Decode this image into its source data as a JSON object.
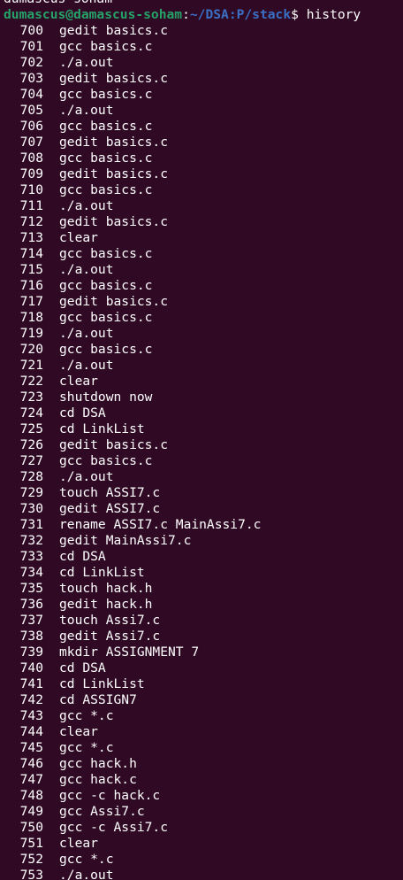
{
  "terminal": {
    "background": "#300a24",
    "previous_line": "dumascus-soham",
    "prompt": {
      "user_host": "dumascus@damascus-soham",
      "separator": ":",
      "path": "~/DSA:P/stack",
      "symbol": "$",
      "command": " history"
    },
    "history": [
      {
        "num": "700",
        "cmd": "gedit basics.c"
      },
      {
        "num": "701",
        "cmd": "gcc basics.c"
      },
      {
        "num": "702",
        "cmd": "./a.out"
      },
      {
        "num": "703",
        "cmd": "gedit basics.c"
      },
      {
        "num": "704",
        "cmd": "gcc basics.c"
      },
      {
        "num": "705",
        "cmd": "./a.out"
      },
      {
        "num": "706",
        "cmd": "gcc basics.c"
      },
      {
        "num": "707",
        "cmd": "gedit basics.c"
      },
      {
        "num": "708",
        "cmd": "gcc basics.c"
      },
      {
        "num": "709",
        "cmd": "gedit basics.c"
      },
      {
        "num": "710",
        "cmd": "gcc basics.c"
      },
      {
        "num": "711",
        "cmd": "./a.out"
      },
      {
        "num": "712",
        "cmd": "gedit basics.c"
      },
      {
        "num": "713",
        "cmd": "clear"
      },
      {
        "num": "714",
        "cmd": "gcc basics.c"
      },
      {
        "num": "715",
        "cmd": "./a.out"
      },
      {
        "num": "716",
        "cmd": "gcc basics.c"
      },
      {
        "num": "717",
        "cmd": "gedit basics.c"
      },
      {
        "num": "718",
        "cmd": "gcc basics.c"
      },
      {
        "num": "719",
        "cmd": "./a.out"
      },
      {
        "num": "720",
        "cmd": "gcc basics.c"
      },
      {
        "num": "721",
        "cmd": "./a.out"
      },
      {
        "num": "722",
        "cmd": "clear"
      },
      {
        "num": "723",
        "cmd": "shutdown now"
      },
      {
        "num": "724",
        "cmd": "cd DSA"
      },
      {
        "num": "725",
        "cmd": "cd LinkList"
      },
      {
        "num": "726",
        "cmd": "gedit basics.c"
      },
      {
        "num": "727",
        "cmd": "gcc basics.c"
      },
      {
        "num": "728",
        "cmd": "./a.out"
      },
      {
        "num": "729",
        "cmd": "touch ASSI7.c"
      },
      {
        "num": "730",
        "cmd": "gedit ASSI7.c"
      },
      {
        "num": "731",
        "cmd": "rename ASSI7.c MainAssi7.c"
      },
      {
        "num": "732",
        "cmd": "gedit MainAssi7.c"
      },
      {
        "num": "733",
        "cmd": "cd DSA"
      },
      {
        "num": "734",
        "cmd": "cd LinkList"
      },
      {
        "num": "735",
        "cmd": "touch hack.h"
      },
      {
        "num": "736",
        "cmd": "gedit hack.h"
      },
      {
        "num": "737",
        "cmd": "touch Assi7.c"
      },
      {
        "num": "738",
        "cmd": "gedit Assi7.c"
      },
      {
        "num": "739",
        "cmd": "mkdir ASSIGNMENT 7"
      },
      {
        "num": "740",
        "cmd": "cd DSA"
      },
      {
        "num": "741",
        "cmd": "cd LinkList"
      },
      {
        "num": "742",
        "cmd": "cd ASSIGN7"
      },
      {
        "num": "743",
        "cmd": "gcc *.c"
      },
      {
        "num": "744",
        "cmd": "clear"
      },
      {
        "num": "745",
        "cmd": "gcc *.c"
      },
      {
        "num": "746",
        "cmd": "gcc hack.h"
      },
      {
        "num": "747",
        "cmd": "gcc hack.c"
      },
      {
        "num": "748",
        "cmd": "gcc -c hack.c"
      },
      {
        "num": "749",
        "cmd": "gcc Assi7.c"
      },
      {
        "num": "750",
        "cmd": "gcc -c Assi7.c"
      },
      {
        "num": "751",
        "cmd": "clear"
      },
      {
        "num": "752",
        "cmd": "gcc *.c"
      },
      {
        "num": "753",
        "cmd": "./a.out"
      }
    ]
  }
}
